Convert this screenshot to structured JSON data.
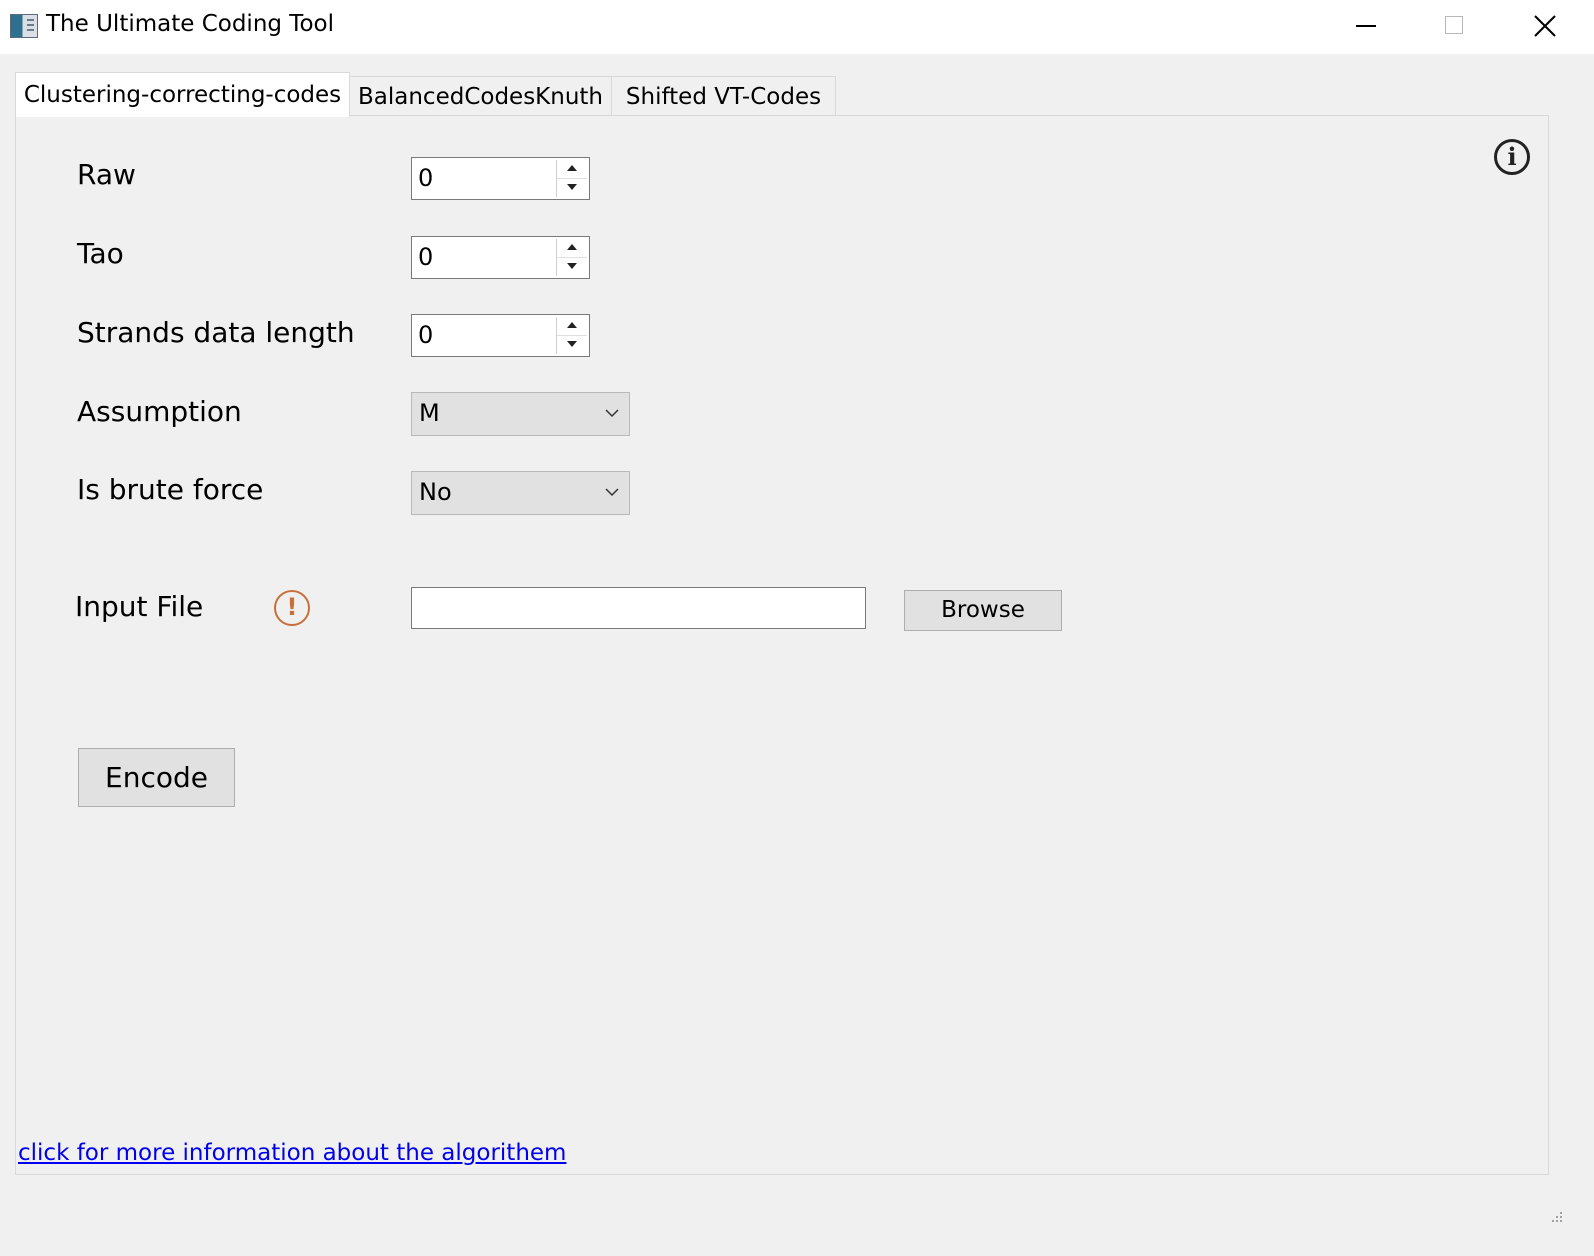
{
  "window": {
    "title": "The Ultimate Coding Tool"
  },
  "tabs": [
    {
      "label": "Clustering-correcting-codes",
      "active": true
    },
    {
      "label": "BalancedCodesKnuth",
      "active": false
    },
    {
      "label": "Shifted VT-Codes",
      "active": false
    }
  ],
  "form": {
    "raw": {
      "label": "Raw",
      "value": "0"
    },
    "tao": {
      "label": "Tao",
      "value": "0"
    },
    "strands": {
      "label": "Strands data length",
      "value": "0"
    },
    "assumption": {
      "label": "Assumption",
      "value": "M"
    },
    "brute_force": {
      "label": "Is brute force",
      "value": "No"
    },
    "input_file": {
      "label": "Input File",
      "value": "",
      "browse_label": "Browse"
    }
  },
  "actions": {
    "encode_label": "Encode"
  },
  "footer": {
    "link_text": "click for more information about the algorithem"
  },
  "colors": {
    "warning": "#c9703a",
    "link": "#0000ee"
  },
  "icons": {
    "warning": "exclamation-circle-icon",
    "info": "info-circle-icon"
  }
}
